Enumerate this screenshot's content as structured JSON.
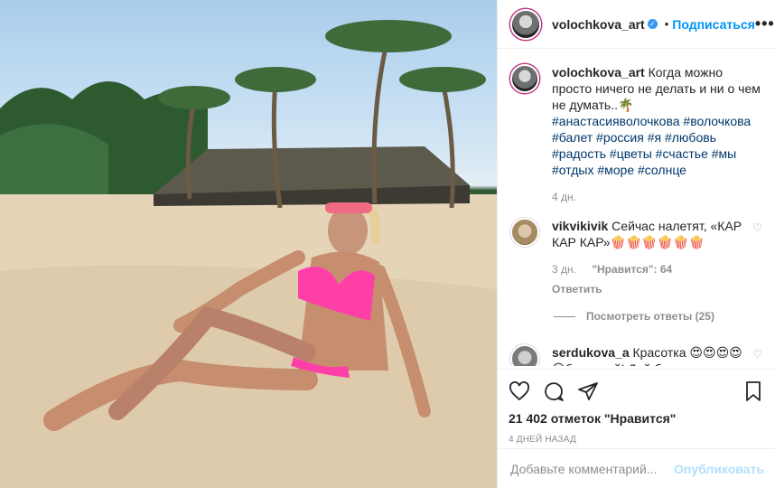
{
  "post": {
    "username": "volochkova_art",
    "follow_label": "Подписаться",
    "more_label": "•••",
    "caption_text": "Когда можно просто ничего не делать и ни о чем не думать..🌴",
    "hashtags_line1": "#анастасияволочкова #волочкова",
    "hashtags_line2": "#балет #россия #я #любовь",
    "hashtags_line3": "#радость #цветы #счастье #мы",
    "hashtags_line4": "#отдых #море #солнце",
    "caption_time": "4 дн."
  },
  "comments": [
    {
      "username": "vikvikivik",
      "text": "Сейчас налетят, «КАР КАР КАР»🍿🍿🍿🍿🍿🍿",
      "time": "3 дн.",
      "likes": "\"Нравится\": 64",
      "reply_label": "Ответить",
      "view_replies": "Посмотреть ответы (25)"
    },
    {
      "username": "serdukova_a",
      "text": "Красотка 😍😍😍😍😍боже мой! Дай бог всем"
    }
  ],
  "actions": {
    "likes_count": "21 402 отметок \"Нравится\"",
    "posted_ago": "4 ДНЕЙ НАЗАД"
  },
  "add_comment": {
    "placeholder": "Добавьте комментарий...",
    "publish_label": "Опубликовать"
  },
  "colors": {
    "link_blue": "#0095f6",
    "hashtag_blue": "#00376b",
    "muted_gray": "#8e8e8e"
  }
}
